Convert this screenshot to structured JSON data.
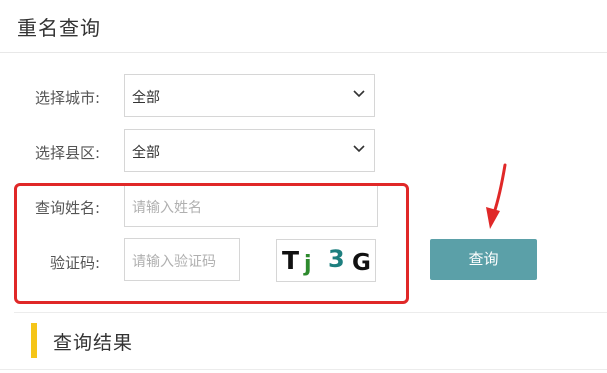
{
  "header": {
    "title": "重名查询"
  },
  "form": {
    "city_label": "选择城市:",
    "city_value": "全部",
    "county_label": "选择县区:",
    "county_value": "全部",
    "name_label": "查询姓名:",
    "name_placeholder": "请输入姓名",
    "captcha_label": "验证码:",
    "captcha_placeholder": "请输入验证码",
    "captcha_chars": [
      "T",
      "j",
      "3",
      "G"
    ],
    "query_button": "查询"
  },
  "results": {
    "title": "查询结果"
  },
  "colors": {
    "button": "#5ba0a8",
    "highlight_box": "#e02828",
    "section_accent": "#f5c518"
  }
}
